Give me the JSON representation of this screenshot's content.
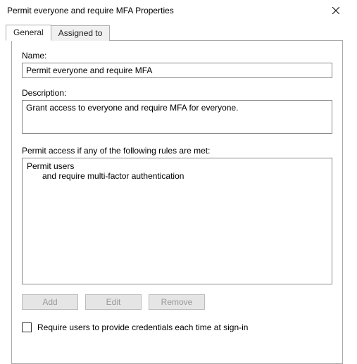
{
  "window": {
    "title": "Permit everyone and require MFA Properties"
  },
  "tabs": {
    "general": "General",
    "assigned_to": "Assigned to"
  },
  "fields": {
    "name_label": "Name:",
    "name_value": "Permit everyone and require MFA",
    "description_label": "Description:",
    "description_value": "Grant access to everyone and require MFA for everyone.",
    "rules_label": "Permit access if any of the following rules are met:",
    "rules_line1": "Permit users",
    "rules_line2": "and require multi-factor authentication"
  },
  "buttons": {
    "add": "Add",
    "edit": "Edit",
    "remove": "Remove"
  },
  "checkbox": {
    "label": "Require users to provide credentials each time at sign-in",
    "checked": false
  }
}
